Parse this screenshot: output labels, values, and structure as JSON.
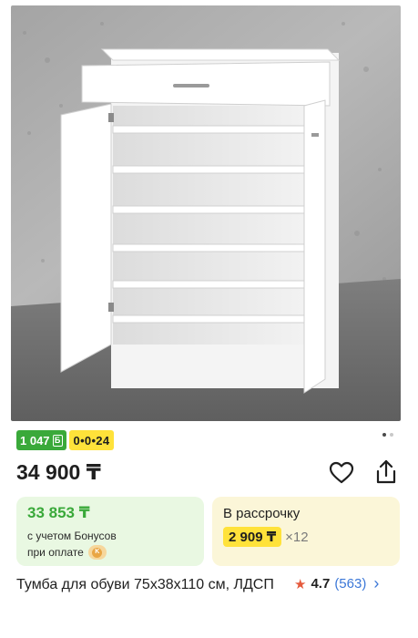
{
  "gallery": {
    "image_alt": "Shoe cabinet with drawer and open doors",
    "active_index": 0,
    "total": 2
  },
  "badges": {
    "bonus_amount": "1 047",
    "bonus_currency_icon": "Б",
    "installment": "0•0•24"
  },
  "price": "34 900 ₸",
  "bonus_card": {
    "price": "33 853 ₸",
    "note_line1": "с учетом Бонусов",
    "note_line2": "при оплате",
    "pay_icon": "wallet-icon"
  },
  "installment_card": {
    "title": "В рассрочку",
    "monthly": "2 909 ₸",
    "times": "×12"
  },
  "product": {
    "title": "Тумба для обуви 75x38x110 см, ЛДСП",
    "rating": "4.7",
    "reviews": "(563)"
  },
  "colors": {
    "bonus_green": "#3aa93a",
    "installment_yellow": "#ffe23a",
    "link_blue": "#3c78d8",
    "star_red": "#e55a3c"
  }
}
